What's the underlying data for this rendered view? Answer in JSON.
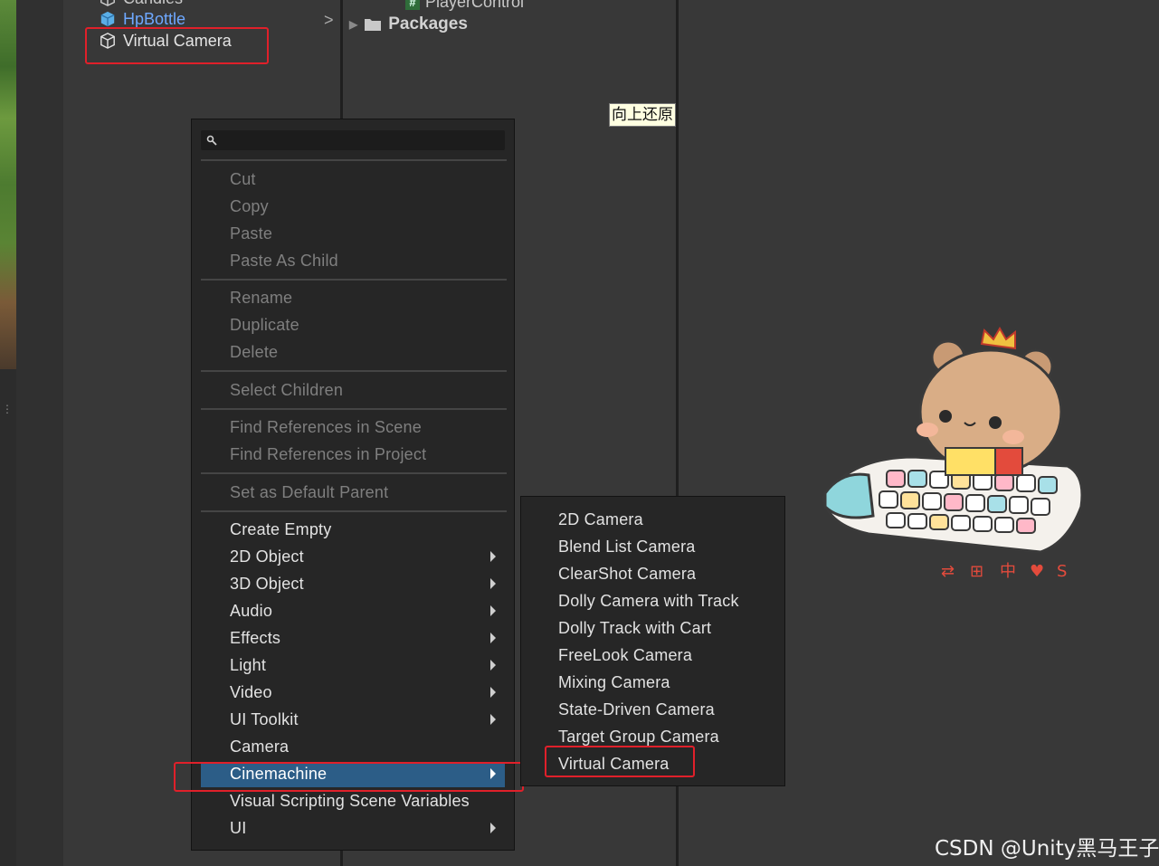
{
  "hierarchy": {
    "rows": [
      {
        "label": "Candles"
      },
      {
        "label": "HpBottle"
      },
      {
        "label": "Virtual Camera"
      }
    ]
  },
  "project": {
    "script_item": "PlayerControl",
    "packages_label": "Packages"
  },
  "tooltip": {
    "text": "向上还原"
  },
  "context_menu": {
    "search": {
      "value": "",
      "icon": "search-icon"
    },
    "items": [
      {
        "label": "Cut",
        "enabled": false
      },
      {
        "label": "Copy",
        "enabled": false
      },
      {
        "label": "Paste",
        "enabled": false
      },
      {
        "label": "Paste As Child",
        "enabled": false
      },
      {
        "label": "Rename",
        "enabled": false
      },
      {
        "label": "Duplicate",
        "enabled": false
      },
      {
        "label": "Delete",
        "enabled": false
      },
      {
        "label": "Select Children",
        "enabled": false
      },
      {
        "label": "Find References in Scene",
        "enabled": false
      },
      {
        "label": "Find References in Project",
        "enabled": false
      },
      {
        "label": "Set as Default Parent",
        "enabled": false
      },
      {
        "label": "Create Empty",
        "enabled": true
      },
      {
        "label": "2D Object",
        "enabled": true,
        "submenu": true
      },
      {
        "label": "3D Object",
        "enabled": true,
        "submenu": true
      },
      {
        "label": "Audio",
        "enabled": true,
        "submenu": true
      },
      {
        "label": "Effects",
        "enabled": true,
        "submenu": true
      },
      {
        "label": "Light",
        "enabled": true,
        "submenu": true
      },
      {
        "label": "Video",
        "enabled": true,
        "submenu": true
      },
      {
        "label": "UI Toolkit",
        "enabled": true,
        "submenu": true
      },
      {
        "label": "Camera",
        "enabled": true
      },
      {
        "label": "Cinemachine",
        "enabled": true,
        "submenu": true,
        "highlighted": true
      },
      {
        "label": "Visual Scripting Scene Variables",
        "enabled": true
      },
      {
        "label": "UI",
        "enabled": true,
        "submenu": true
      }
    ]
  },
  "cinemachine_submenu": {
    "items": [
      {
        "label": "2D Camera"
      },
      {
        "label": "Blend List Camera"
      },
      {
        "label": "ClearShot Camera"
      },
      {
        "label": "Dolly Camera with Track"
      },
      {
        "label": "Dolly Track with Cart"
      },
      {
        "label": "FreeLook Camera"
      },
      {
        "label": "Mixing Camera"
      },
      {
        "label": "State-Driven Camera"
      },
      {
        "label": "Target Group Camera"
      },
      {
        "label": "Virtual Camera"
      }
    ]
  },
  "colors": {
    "highlight": "#2c5d87",
    "annotation_box": "#e0202a",
    "link_blue": "#6ea8ff"
  },
  "watermark": {
    "text": "CSDN @Unity黑马王子"
  }
}
